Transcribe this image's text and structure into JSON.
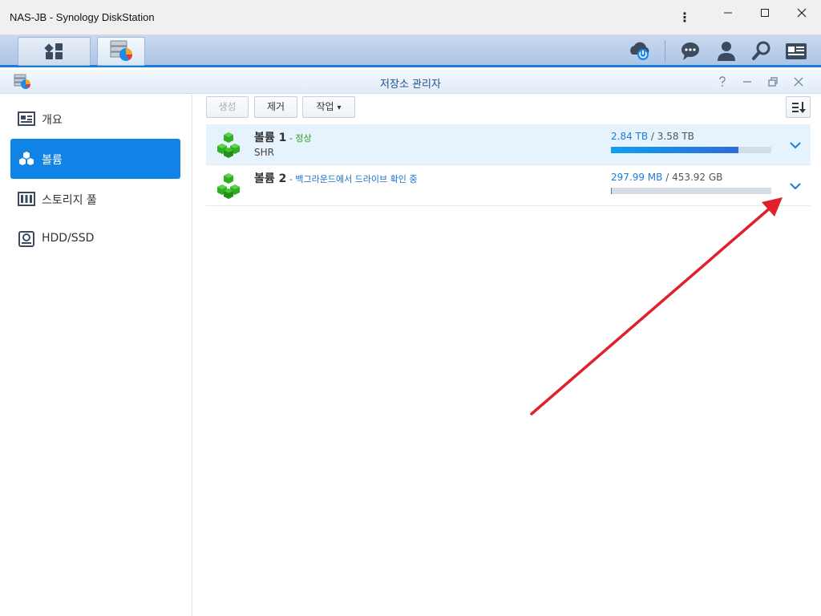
{
  "window": {
    "title": "NAS-JB - Synology DiskStation",
    "kebab_label": "⋮",
    "minimize_label": "—",
    "maximize_label": "☐",
    "close_label": "✕"
  },
  "app": {
    "title": "저장소 관리자"
  },
  "sidebar": {
    "items": [
      {
        "label": "개요",
        "icon": "overview-icon"
      },
      {
        "label": "볼륨",
        "icon": "volume-icon",
        "active": true
      },
      {
        "label": "스토리지 풀",
        "icon": "storage-pool-icon"
      },
      {
        "label": "HDD/SSD",
        "icon": "hdd-icon"
      }
    ]
  },
  "toolbar": {
    "create_label": "생성",
    "remove_label": "제거",
    "action_label": "작업",
    "action_caret": "▾"
  },
  "volumes": [
    {
      "name": "볼륨 1",
      "separator": " - ",
      "status": "정상",
      "type": "SHR",
      "used": "2.84 TB",
      "slash": " / ",
      "total": "3.58 TB",
      "usage_fraction": 0.794
    },
    {
      "name": "볼륨 2",
      "separator": " - ",
      "status": "백그라운드에서 드라이브 확인 중",
      "type": "",
      "used": "297.99 MB",
      "slash": " / ",
      "total": "453.92 GB",
      "usage_fraction": 0.0006
    }
  ],
  "colors": {
    "accent": "#0f83e6",
    "status_ok": "#2f9e1f",
    "volume_icon": "#2fae23",
    "annotation_arrow": "#e0202a"
  }
}
